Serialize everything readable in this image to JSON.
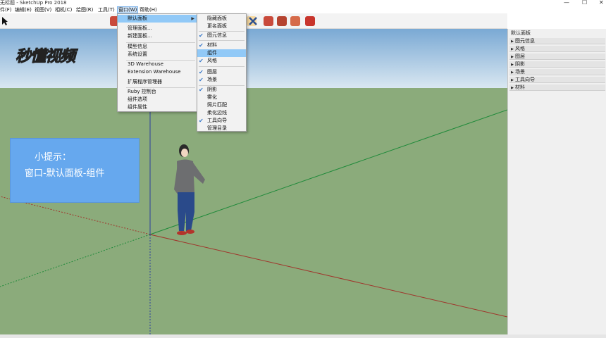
{
  "window": {
    "title": "无标题 - SketchUp Pro 2018",
    "controls": [
      "—",
      "☐",
      "✕"
    ]
  },
  "menubar": {
    "items": [
      "件(F)",
      "编辑(E)",
      "视图(V)",
      "相机(C)",
      "绘图(R)",
      "工具(T)",
      "窗口(W)",
      "帮助(H)"
    ],
    "active": "窗口(W)"
  },
  "window_menu": {
    "items": [
      {
        "label": "默认面板",
        "submenu": true,
        "highlighted": true
      },
      {
        "label": "管理面板..."
      },
      {
        "label": "新建面板..."
      },
      {
        "label": "模型信息"
      },
      {
        "label": "系统设置"
      },
      {
        "label": "3D Warehouse"
      },
      {
        "label": "Extension Warehouse"
      },
      {
        "label": "扩展程序管理器"
      },
      {
        "label": "Ruby 控制台"
      },
      {
        "label": "组件选项"
      },
      {
        "label": "组件属性"
      }
    ]
  },
  "panel_submenu": {
    "items": [
      {
        "label": "隐藏面板",
        "checked": false
      },
      {
        "label": "更名面板",
        "checked": false
      },
      {
        "label": "图元信息",
        "checked": true
      },
      {
        "label": "材料",
        "checked": true
      },
      {
        "label": "组件",
        "checked": false,
        "highlighted": true
      },
      {
        "label": "风格",
        "checked": true
      },
      {
        "label": "图层",
        "checked": true
      },
      {
        "label": "场景",
        "checked": true
      },
      {
        "label": "阴影",
        "checked": true
      },
      {
        "label": "雾化",
        "checked": false
      },
      {
        "label": "照片匹配",
        "checked": false
      },
      {
        "label": "柔化边线",
        "checked": false
      },
      {
        "label": "工具向导",
        "checked": true
      },
      {
        "label": "管理目录",
        "checked": false
      }
    ]
  },
  "tray": {
    "title": "默认面板",
    "items": [
      "图元信息",
      "风格",
      "图层",
      "阴影",
      "场景",
      "工具向导",
      "材料"
    ]
  },
  "hint_box": {
    "line1": "小提示：",
    "line2": "窗口-默认面板-组件"
  },
  "watermark": {
    "text": "秒懂视频"
  },
  "colors": {
    "sky_top": "#7aa9d4",
    "sky_bottom": "#d9e7f1",
    "ground": "#8bab7b",
    "hint_bg": "#66a8ee",
    "menu_highlight": "#91c9f7",
    "check": "#3a79c9"
  }
}
